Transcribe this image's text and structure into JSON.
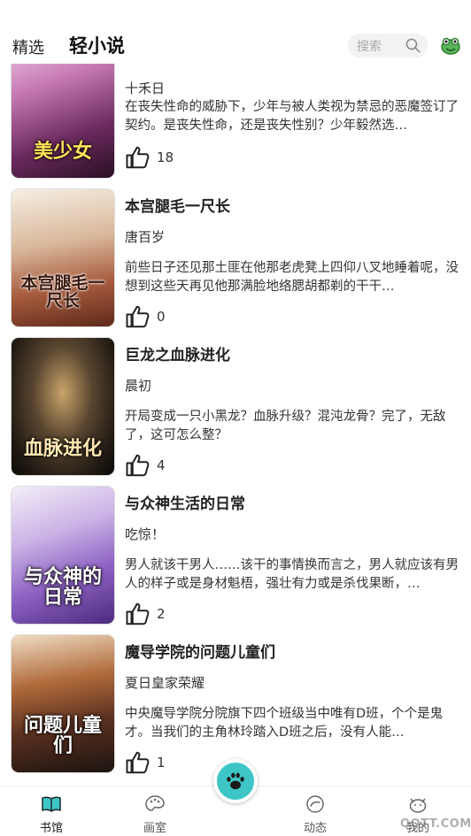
{
  "header": {
    "tab_featured": "精选",
    "tab_main": "轻小说",
    "search_placeholder": "搜索",
    "accent_color": "#3ec6c6"
  },
  "books": [
    {
      "title": "",
      "author": "十禾日",
      "desc": "在丧失性命的威胁下，少年与被人类视为禁忌的恶魔签订了契约。是丧失性命，还是丧失性别？少年毅然选…",
      "likes": "18",
      "cover_text": "美少女"
    },
    {
      "title": "本宫腿毛一尺长",
      "author": "唐百岁",
      "desc": "前些日子还见那土匪在他那老虎凳上四仰八叉地睡着呢，没想到这些天再见他那满脸地络腮胡都剃的干干…",
      "likes": "0",
      "cover_text": "本宫腿毛一尺长"
    },
    {
      "title": "巨龙之血脉进化",
      "author": "晨初",
      "desc": "开局变成一只小黑龙？血脉升级？混沌龙骨？完了，无敌了，这可怎么整？",
      "likes": "4",
      "cover_text": "血脉进化"
    },
    {
      "title": "与众神生活的日常",
      "author": "吃惊！",
      "desc": "男人就该干男人……该干的事情换而言之，男人就应该有男人的样子或是身材魁梧，强壮有力或是杀伐果断，…",
      "likes": "2",
      "cover_text": "与众神的日常"
    },
    {
      "title": "魔导学院的问题儿童们",
      "author": "夏日皇家荣耀",
      "desc": "中央魔导学院分院旗下四个班级当中唯有D班，个个是鬼才。当我们的主角林玲踏入D班之后，没有人能…",
      "likes": "1",
      "cover_text": "问题儿童们"
    }
  ],
  "tabbar": {
    "bookshelf": "书馆",
    "studio": "画室",
    "moments": "动态",
    "mine": "我的"
  },
  "watermark": "QQTT.COM"
}
